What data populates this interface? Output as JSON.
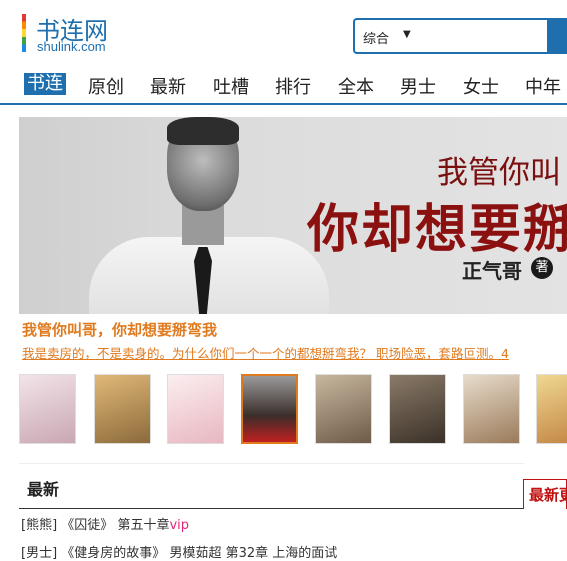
{
  "header": {
    "logo_cn": "书连网",
    "logo_en": "shulink.com",
    "search_select": "综合"
  },
  "nav": [
    "书连",
    "原创",
    "最新",
    "吐槽",
    "排行",
    "全本",
    "男士",
    "女士",
    "中年"
  ],
  "banner": {
    "subtitle": "我管你叫",
    "main": "你却想要掰",
    "author": "正气哥",
    "author_mark": "著"
  },
  "feature": {
    "title": "我管你叫哥，你却想要掰弯我",
    "desc": "我是卖房的，不是卖身的。为什么你们一个一个的都想掰弯我？ 职场险恶，套路叵测。4"
  },
  "thumbnails": [
    {
      "label": "cover-1",
      "color": "#e9d7dc"
    },
    {
      "label": "cover-2",
      "color": "#c9a36b"
    },
    {
      "label": "cover-3",
      "color": "#f3dde0"
    },
    {
      "label": "cover-4",
      "color": "#5b4a45"
    },
    {
      "label": "cover-5",
      "color": "#8c7a66"
    },
    {
      "label": "cover-6",
      "color": "#6a5a4a"
    },
    {
      "label": "cover-7",
      "color": "#b89a7a"
    },
    {
      "label": "cover-8",
      "color": "#d8c7a0"
    }
  ],
  "latest": {
    "title": "最新",
    "tab": "最新更",
    "rows": [
      {
        "tag": "[熊熊]",
        "book": "《囚徒》",
        "chapter": "第五十章",
        "extra": "vip"
      },
      {
        "tag": "[男士]",
        "book": "《健身房的故事》",
        "chapter": "男模茹超 第32章 上海的面试",
        "extra": ""
      }
    ]
  },
  "colors": {
    "brand": "#1f6fae",
    "accent": "#e07a1e",
    "banner_red": "#8b1111"
  }
}
